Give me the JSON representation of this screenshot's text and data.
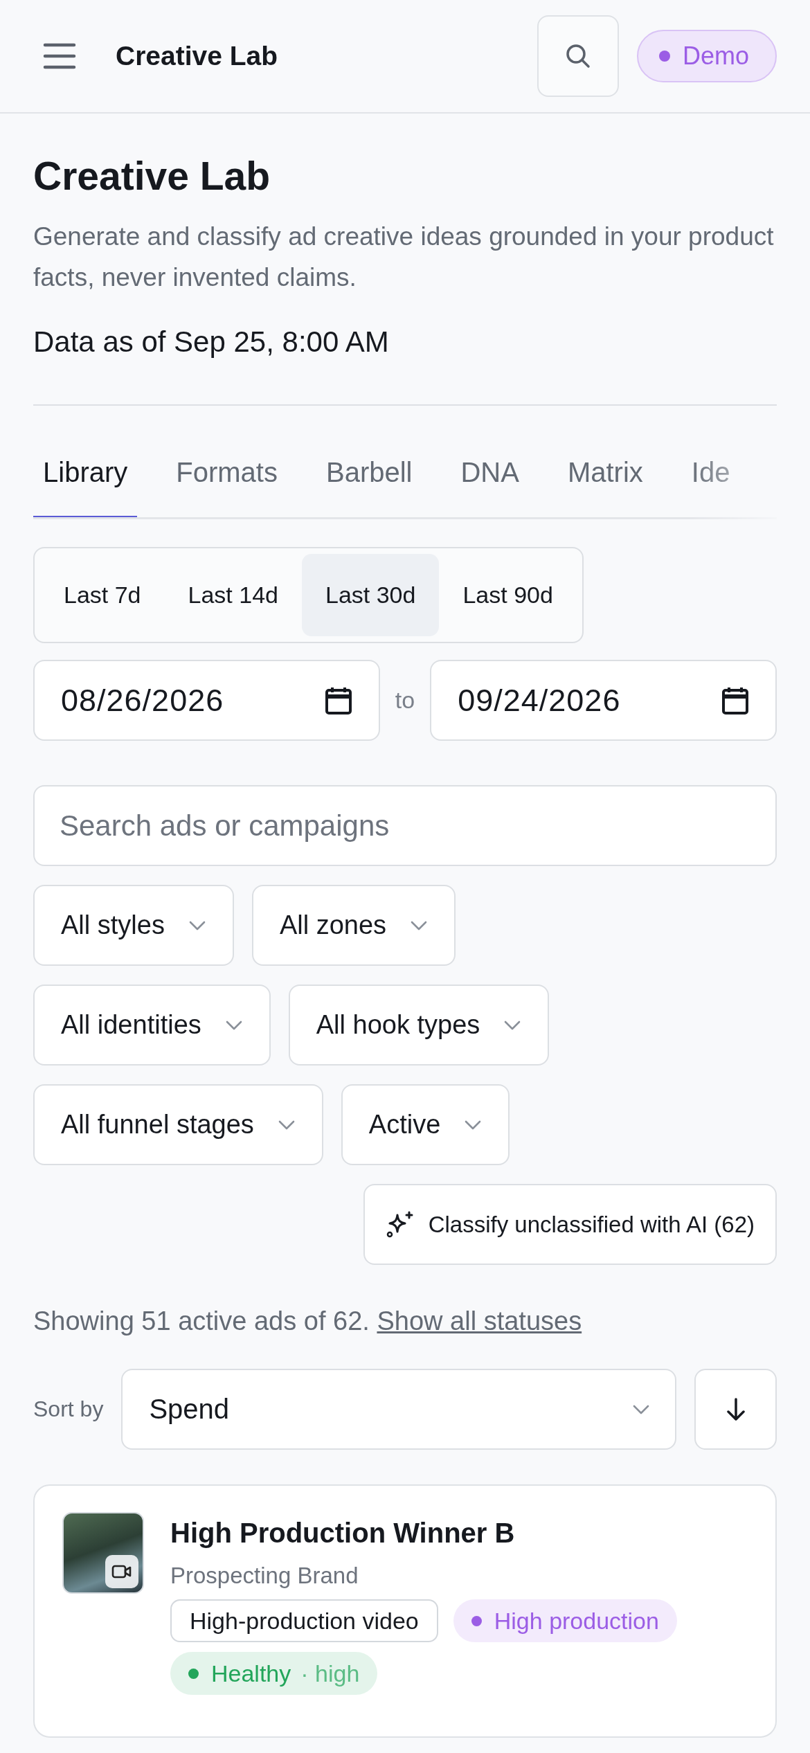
{
  "header": {
    "title": "Creative Lab",
    "badge": "Demo"
  },
  "intro": {
    "title": "Creative Lab",
    "description": "Generate and classify ad creative ideas grounded in your product facts, never invented claims.",
    "data_as_of": "Data as of Sep 25, 8:00 AM"
  },
  "tabs": [
    {
      "label": "Library",
      "selected": true
    },
    {
      "label": "Formats",
      "selected": false
    },
    {
      "label": "Barbell",
      "selected": false
    },
    {
      "label": "DNA",
      "selected": false
    },
    {
      "label": "Matrix",
      "selected": false
    },
    {
      "label": "Ide",
      "selected": false
    }
  ],
  "ranges": [
    {
      "label": "Last 7d",
      "selected": false
    },
    {
      "label": "Last 14d",
      "selected": false
    },
    {
      "label": "Last 30d",
      "selected": true
    },
    {
      "label": "Last 90d",
      "selected": false
    }
  ],
  "date_range": {
    "from": "08/26/2026",
    "separator": "to",
    "to": "09/24/2026"
  },
  "search": {
    "placeholder": "Search ads or campaigns"
  },
  "filter_rows": [
    [
      "All styles",
      "All zones"
    ],
    [
      "All identities",
      "All hook types"
    ],
    [
      "All funnel stages",
      "Active"
    ]
  ],
  "classify_button": "Classify unclassified with AI (62)",
  "summary": {
    "text": "Showing 51 active ads of 62.",
    "link": "Show all statuses"
  },
  "sort": {
    "label": "Sort by",
    "value": "Spend"
  },
  "ads": [
    {
      "title": "High Production Winner B",
      "subtitle": "Prospecting Brand",
      "tags": [
        {
          "kind": "outline",
          "label": "High-production video"
        },
        {
          "kind": "dot",
          "label": "High production",
          "color": "#9b5de5"
        },
        {
          "kind": "dot",
          "label": "Healthy",
          "detail": "· high",
          "color": "#22a55a"
        }
      ]
    }
  ]
}
